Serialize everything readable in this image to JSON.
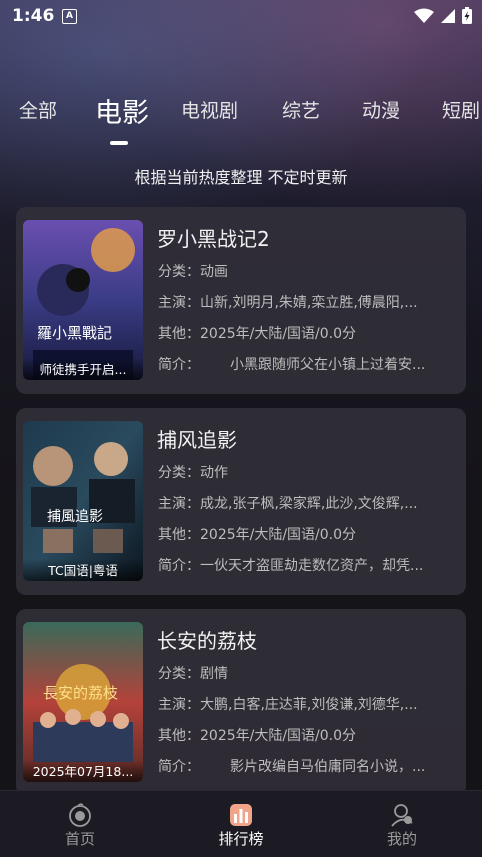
{
  "status_bar": {
    "time": "1:46",
    "notification_letter": "A"
  },
  "tabs": [
    {
      "label": "全部"
    },
    {
      "label": "电影"
    },
    {
      "label": "电视剧"
    },
    {
      "label": "综艺"
    },
    {
      "label": "动漫"
    },
    {
      "label": "短剧"
    }
  ],
  "active_tab": "电影",
  "subtitle": "根据当前热度整理 不定时更新",
  "movies": [
    {
      "title": "罗小黑战记2",
      "category_label": "分类：",
      "category": "动画",
      "cast_label": "主演：",
      "cast": "山新,刘明月,朱婧,栾立胜,傅晨阳,...",
      "other_label": "其他：",
      "other": "2025年/大陆/国语/0.0分",
      "intro_label": "简介：",
      "intro": "小黑跟随师父在小镇上过着安...",
      "poster_caption": "师徒携手开启...",
      "poster_text": "羅小黑戰記"
    },
    {
      "title": "捕风追影",
      "category_label": "分类：",
      "category": "动作",
      "cast_label": "主演：",
      "cast": "成龙,张子枫,梁家辉,此沙,文俊辉,...",
      "other_label": "其他：",
      "other": "2025年/大陆/国语/0.0分",
      "intro_label": "简介：",
      "intro": "一伙天才盗匪劫走数亿资产，却凭...",
      "poster_caption": "TC国语|粤语",
      "poster_text": "捕風追影"
    },
    {
      "title": "长安的荔枝",
      "category_label": "分类：",
      "category": "剧情",
      "cast_label": "主演：",
      "cast": "大鹏,白客,庄达菲,刘俊谦,刘德华,...",
      "other_label": "其他：",
      "other": "2025年/大陆/国语/0.0分",
      "intro_label": "简介：",
      "intro": "影片改编自马伯庸同名小说，...",
      "poster_caption": "2025年07月18...",
      "poster_text": "長安的荔枝"
    }
  ],
  "bottom_nav": [
    {
      "label": "首页",
      "icon": "home-icon"
    },
    {
      "label": "排行榜",
      "icon": "ranking-icon"
    },
    {
      "label": "我的",
      "icon": "profile-icon"
    }
  ],
  "active_nav": "排行榜",
  "colors": {
    "background": "#151419",
    "card": "#32303a",
    "accent": "#f2a48a"
  }
}
